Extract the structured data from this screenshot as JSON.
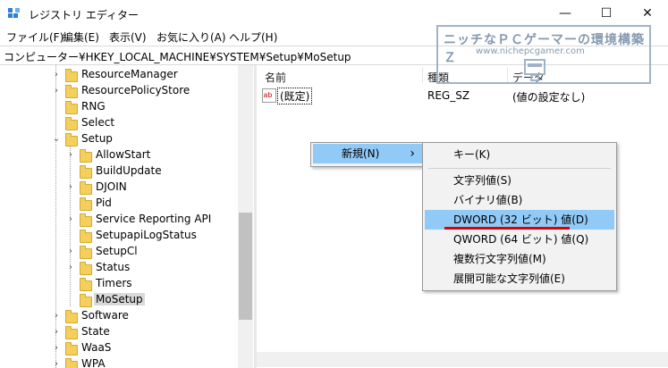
{
  "window": {
    "title": "レジストリ エディター",
    "buttons": {
      "minimize": "—",
      "maximize": "☐",
      "close": "✕"
    }
  },
  "menu": [
    "ファイル(F)",
    "編集(E)",
    "表示(V)",
    "お気に入り(A)",
    "ヘルプ(H)"
  ],
  "address": "コンピューター¥HKEY_LOCAL_MACHINE¥SYSTEM¥Setup¥MoSetup",
  "tree": {
    "items": [
      {
        "label": "ResourceManager",
        "level": 0,
        "expand": "›"
      },
      {
        "label": "ResourcePolicyStore",
        "level": 0,
        "expand": "›"
      },
      {
        "label": "RNG",
        "level": 0,
        "expand": ""
      },
      {
        "label": "Select",
        "level": 0,
        "expand": ""
      },
      {
        "label": "Setup",
        "level": 0,
        "expand": "⌄"
      },
      {
        "label": "AllowStart",
        "level": 1,
        "expand": "›"
      },
      {
        "label": "BuildUpdate",
        "level": 1,
        "expand": ""
      },
      {
        "label": "DJOIN",
        "level": 1,
        "expand": "›"
      },
      {
        "label": "Pid",
        "level": 1,
        "expand": ""
      },
      {
        "label": "Service Reporting API",
        "level": 1,
        "expand": "›"
      },
      {
        "label": "SetupapiLogStatus",
        "level": 1,
        "expand": ""
      },
      {
        "label": "SetupCl",
        "level": 1,
        "expand": "›"
      },
      {
        "label": "Status",
        "level": 1,
        "expand": "›"
      },
      {
        "label": "Timers",
        "level": 1,
        "expand": ""
      },
      {
        "label": "MoSetup",
        "level": 1,
        "expand": "",
        "selected": true
      },
      {
        "label": "Software",
        "level": 0,
        "expand": "›"
      },
      {
        "label": "State",
        "level": 0,
        "expand": "›"
      },
      {
        "label": "WaaS",
        "level": 0,
        "expand": "›"
      },
      {
        "label": "WPA",
        "level": 0,
        "expand": "›"
      }
    ]
  },
  "list": {
    "columns": {
      "name": "名前",
      "type": "種類",
      "data": "データ"
    },
    "rows": [
      {
        "icon": "ab",
        "name": "(既定)",
        "type": "REG_SZ",
        "data": "(値の設定なし)"
      }
    ]
  },
  "context_menu": {
    "new": {
      "label": "新規(N)",
      "arrow": "›"
    },
    "submenu": [
      {
        "label": "キー(K)"
      },
      {
        "label": "文字列値(S)"
      },
      {
        "label": "バイナリ値(B)"
      },
      {
        "label": "DWORD (32 ビット) 値(D)",
        "highlighted": true
      },
      {
        "label": "QWORD (64 ビット) 値(Q)"
      },
      {
        "label": "複数行文字列値(M)"
      },
      {
        "label": "展開可能な文字列値(E)"
      }
    ]
  },
  "watermark": {
    "title": "ニッチなＰＣゲーマーの環境構築Ｚ",
    "url": "www.nichepcgamer.com"
  },
  "colors": {
    "highlight": "#91c9f7",
    "selected": "#d9d9d9",
    "folder": "#f4cf5e",
    "annotation": "#e00000"
  }
}
